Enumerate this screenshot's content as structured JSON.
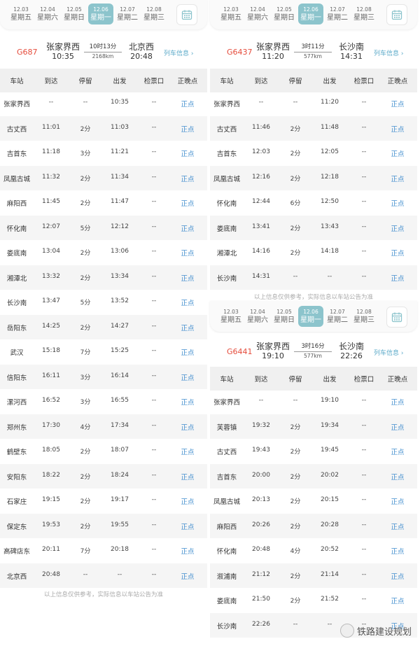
{
  "dates": [
    {
      "date": "12.03",
      "week": "星期五"
    },
    {
      "date": "12.04",
      "week": "星期六"
    },
    {
      "date": "12.05",
      "week": "星期日"
    },
    {
      "date": "12.06",
      "week": "星期一"
    },
    {
      "date": "12.07",
      "week": "星期二"
    },
    {
      "date": "12.08",
      "week": "星期三"
    }
  ],
  "columns": [
    "车站",
    "到达",
    "停留",
    "出发",
    "检票口",
    "正晚点"
  ],
  "info_label": "列车信息 ›",
  "note": "以上信息仅供参考，实际信息以车站公告为准",
  "watermark": "铁路建设规划",
  "trains": [
    {
      "number": "G687",
      "from": "张家界西",
      "from_time": "10:35",
      "duration": "10时13分",
      "distance": "2168km",
      "to": "北京西",
      "to_time": "20:48",
      "stops": [
        [
          "张家界西",
          "--",
          "--",
          "10:35",
          "--",
          "正点"
        ],
        [
          "古丈西",
          "11:01",
          "2分",
          "11:03",
          "--",
          "正点"
        ],
        [
          "吉首东",
          "11:18",
          "3分",
          "11:21",
          "--",
          "正点"
        ],
        [
          "凤凰古城",
          "11:32",
          "2分",
          "11:34",
          "--",
          "正点"
        ],
        [
          "麻阳西",
          "11:45",
          "2分",
          "11:47",
          "--",
          "正点"
        ],
        [
          "怀化南",
          "12:07",
          "5分",
          "12:12",
          "--",
          "正点"
        ],
        [
          "娄底南",
          "13:04",
          "2分",
          "13:06",
          "--",
          "正点"
        ],
        [
          "湘潭北",
          "13:32",
          "2分",
          "13:34",
          "--",
          "正点"
        ],
        [
          "长沙南",
          "13:47",
          "5分",
          "13:52",
          "--",
          "正点"
        ],
        [
          "岳阳东",
          "14:25",
          "2分",
          "14:27",
          "--",
          "正点"
        ],
        [
          "武汉",
          "15:18",
          "7分",
          "15:25",
          "--",
          "正点"
        ],
        [
          "信阳东",
          "16:11",
          "3分",
          "16:14",
          "--",
          "正点"
        ],
        [
          "漯河西",
          "16:52",
          "3分",
          "16:55",
          "--",
          "正点"
        ],
        [
          "郑州东",
          "17:30",
          "4分",
          "17:34",
          "--",
          "正点"
        ],
        [
          "鹤壁东",
          "18:05",
          "2分",
          "18:07",
          "--",
          "正点"
        ],
        [
          "安阳东",
          "18:22",
          "2分",
          "18:24",
          "--",
          "正点"
        ],
        [
          "石家庄",
          "19:15",
          "2分",
          "19:17",
          "--",
          "正点"
        ],
        [
          "保定东",
          "19:53",
          "2分",
          "19:55",
          "--",
          "正点"
        ],
        [
          "高碑店东",
          "20:11",
          "7分",
          "20:18",
          "--",
          "正点"
        ],
        [
          "北京西",
          "20:48",
          "--",
          "--",
          "--",
          "正点"
        ]
      ]
    },
    {
      "number": "G6437",
      "from": "张家界西",
      "from_time": "11:20",
      "duration": "3时11分",
      "distance": "577km",
      "to": "长沙南",
      "to_time": "14:31",
      "stops": [
        [
          "张家界西",
          "--",
          "--",
          "11:20",
          "--",
          "正点"
        ],
        [
          "古丈西",
          "11:46",
          "2分",
          "11:48",
          "--",
          "正点"
        ],
        [
          "吉首东",
          "12:03",
          "2分",
          "12:05",
          "--",
          "正点"
        ],
        [
          "凤凰古城",
          "12:16",
          "2分",
          "12:18",
          "--",
          "正点"
        ],
        [
          "怀化南",
          "12:44",
          "6分",
          "12:50",
          "--",
          "正点"
        ],
        [
          "娄底南",
          "13:41",
          "2分",
          "13:43",
          "--",
          "正点"
        ],
        [
          "湘潭北",
          "14:16",
          "2分",
          "14:18",
          "--",
          "正点"
        ],
        [
          "长沙南",
          "14:31",
          "--",
          "--",
          "--",
          "正点"
        ]
      ]
    },
    {
      "number": "G6441",
      "from": "张家界西",
      "from_time": "19:10",
      "duration": "3时16分",
      "distance": "577km",
      "to": "长沙南",
      "to_time": "22:26",
      "stops": [
        [
          "张家界西",
          "--",
          "--",
          "19:10",
          "--",
          "正点"
        ],
        [
          "芙蓉镇",
          "19:32",
          "2分",
          "19:34",
          "--",
          "正点"
        ],
        [
          "古丈西",
          "19:43",
          "2分",
          "19:45",
          "--",
          "正点"
        ],
        [
          "吉首东",
          "20:00",
          "2分",
          "20:02",
          "--",
          "正点"
        ],
        [
          "凤凰古城",
          "20:13",
          "2分",
          "20:15",
          "--",
          "正点"
        ],
        [
          "麻阳西",
          "20:26",
          "2分",
          "20:28",
          "--",
          "正点"
        ],
        [
          "怀化南",
          "20:48",
          "4分",
          "20:52",
          "--",
          "正点"
        ],
        [
          "溆浦南",
          "21:12",
          "2分",
          "21:14",
          "--",
          "正点"
        ],
        [
          "娄底南",
          "21:50",
          "2分",
          "21:52",
          "--",
          "正点"
        ],
        [
          "长沙南",
          "22:26",
          "--",
          "--",
          "--",
          "正点"
        ]
      ]
    }
  ]
}
